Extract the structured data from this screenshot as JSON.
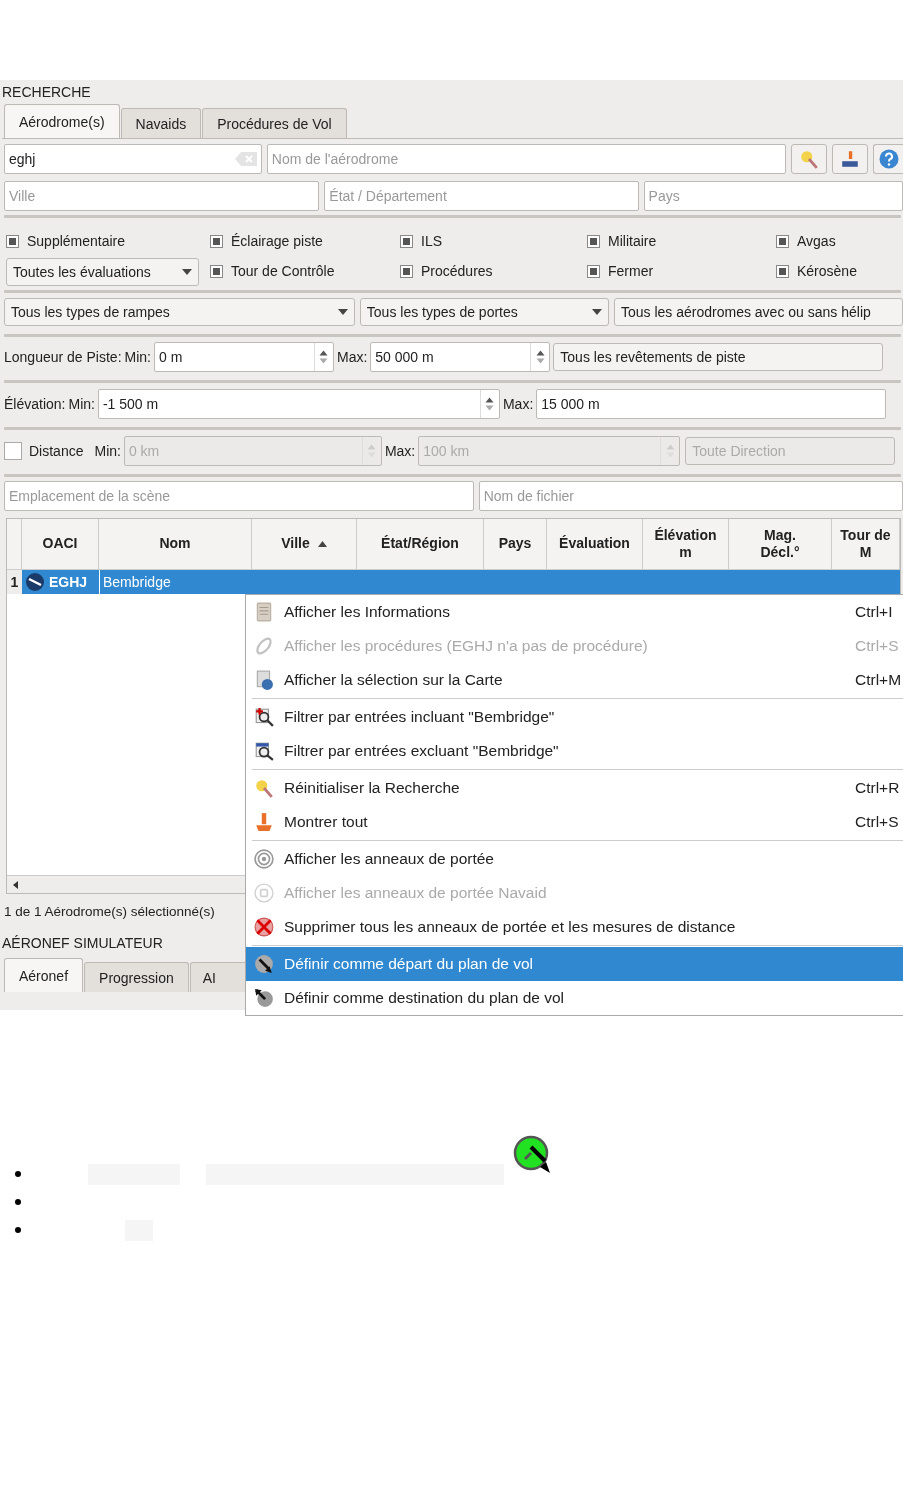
{
  "section_title": "RECHERCHE",
  "tabs": [
    {
      "label": "Aérodrome(s)",
      "selected": true
    },
    {
      "label": "Navaids",
      "selected": false
    },
    {
      "label": "Procédures de Vol",
      "selected": false
    }
  ],
  "search": {
    "value": "eghj"
  },
  "name_field": {
    "placeholder": "Nom de l'aérodrome"
  },
  "location_fields": [
    {
      "placeholder": "Ville"
    },
    {
      "placeholder": "État / Département"
    },
    {
      "placeholder": "Pays"
    }
  ],
  "filters": [
    {
      "kind": "checkbox",
      "label": "Supplémentaire",
      "partially_checked": true
    },
    {
      "kind": "checkbox",
      "label": "Éclairage piste",
      "partially_checked": true
    },
    {
      "kind": "checkbox",
      "label": "ILS",
      "partially_checked": true
    },
    {
      "kind": "checkbox",
      "label": "Militaire",
      "partially_checked": true
    },
    {
      "kind": "checkbox",
      "label": "Avgas",
      "partially_checked": true
    },
    {
      "kind": "dropdown",
      "label": "Toutes les évaluations"
    },
    {
      "kind": "checkbox",
      "label": "Tour de Contrôle",
      "partially_checked": true
    },
    {
      "kind": "checkbox",
      "label": "Procédures",
      "partially_checked": true
    },
    {
      "kind": "checkbox",
      "label": "Fermer",
      "partially_checked": true
    },
    {
      "kind": "checkbox",
      "label": "Kérosène",
      "partially_checked": true
    }
  ],
  "type_dropdowns": [
    "Tous les types de rampes",
    "Tous les types de portes",
    "Tous les aérodromes avec ou sans hélip"
  ],
  "runway": {
    "label": "Longueur de Piste:",
    "min_label": "Min:",
    "min": "0 m",
    "max_label": "Max:",
    "max": "50 000 m",
    "surface": "Tous les revêtements de piste"
  },
  "elevation": {
    "label": "Élévation:",
    "min_label": "Min:",
    "min": "-1 500 m",
    "max_label": "Max:",
    "max": "15 000 m"
  },
  "distance": {
    "checked": false,
    "label": "Distance",
    "min_label": "Min:",
    "min": "0 km",
    "max_label": "Max:",
    "max": "100 km",
    "direction": "Toute Direction",
    "disabled": true
  },
  "file_fields": [
    {
      "placeholder": "Emplacement de la scène"
    },
    {
      "placeholder": "Nom de fichier"
    }
  ],
  "table": {
    "columns": [
      {
        "label": "OACI",
        "sorted": false
      },
      {
        "label": "Nom",
        "sorted": false
      },
      {
        "label": "Ville",
        "sorted": true
      },
      {
        "label": "État/Région",
        "sorted": false
      },
      {
        "label": "Pays",
        "sorted": false
      },
      {
        "label": "Évaluation",
        "sorted": false
      },
      {
        "label": "Élévation\nm",
        "sorted": false
      },
      {
        "label": "Mag.\nDécl.°",
        "sorted": false
      },
      {
        "label": "Tour de\nM",
        "sorted": false
      }
    ],
    "rows": [
      {
        "number": "1",
        "icao": "EGHJ",
        "name": "Bembridge",
        "selected": true
      }
    ]
  },
  "status_bar": "1 de 1 Aérodrome(s) sélectionné(s)",
  "aircraft_title": "AÉRONEF SIMULATEUR",
  "aircraft_tabs": [
    {
      "label": "Aéronef",
      "selected": true
    },
    {
      "label": "Progression",
      "selected": false
    },
    {
      "label": "AI",
      "selected": false
    }
  ],
  "context_menu": [
    {
      "kind": "item",
      "label": "Afficher les Informations",
      "shortcut": "Ctrl+I",
      "disabled": false,
      "selected": false
    },
    {
      "kind": "item",
      "label": "Afficher les procédures (EGHJ n'a pas de procédure)",
      "shortcut": "Ctrl+S",
      "disabled": true,
      "selected": false
    },
    {
      "kind": "item",
      "label": "Afficher la sélection sur la Carte",
      "shortcut": "Ctrl+M",
      "disabled": false,
      "selected": false
    },
    {
      "kind": "separator"
    },
    {
      "kind": "item",
      "label": "Filtrer par entrées incluant \"Bembridge\"",
      "disabled": false,
      "selected": false
    },
    {
      "kind": "item",
      "label": "Filtrer par entrées excluant \"Bembridge\"",
      "disabled": false,
      "selected": false
    },
    {
      "kind": "separator"
    },
    {
      "kind": "item",
      "label": "Réinitialiser la Recherche",
      "shortcut": "Ctrl+R",
      "disabled": false,
      "selected": false
    },
    {
      "kind": "item",
      "label": "Montrer tout",
      "shortcut": "Ctrl+S",
      "disabled": false,
      "selected": false
    },
    {
      "kind": "separator"
    },
    {
      "kind": "item",
      "label": "Afficher les anneaux de portée",
      "disabled": false,
      "selected": false
    },
    {
      "kind": "item",
      "label": "Afficher les anneaux de portée Navaid",
      "disabled": true,
      "selected": false
    },
    {
      "kind": "item",
      "label": "Supprimer tous les anneaux de portée et les mesures de distance",
      "disabled": false,
      "selected": false
    },
    {
      "kind": "separator"
    },
    {
      "kind": "item",
      "label": "Définir comme départ du plan de vol",
      "disabled": false,
      "selected": true
    },
    {
      "kind": "item",
      "label": "Définir comme destination du plan de vol",
      "disabled": false,
      "selected": false
    }
  ]
}
